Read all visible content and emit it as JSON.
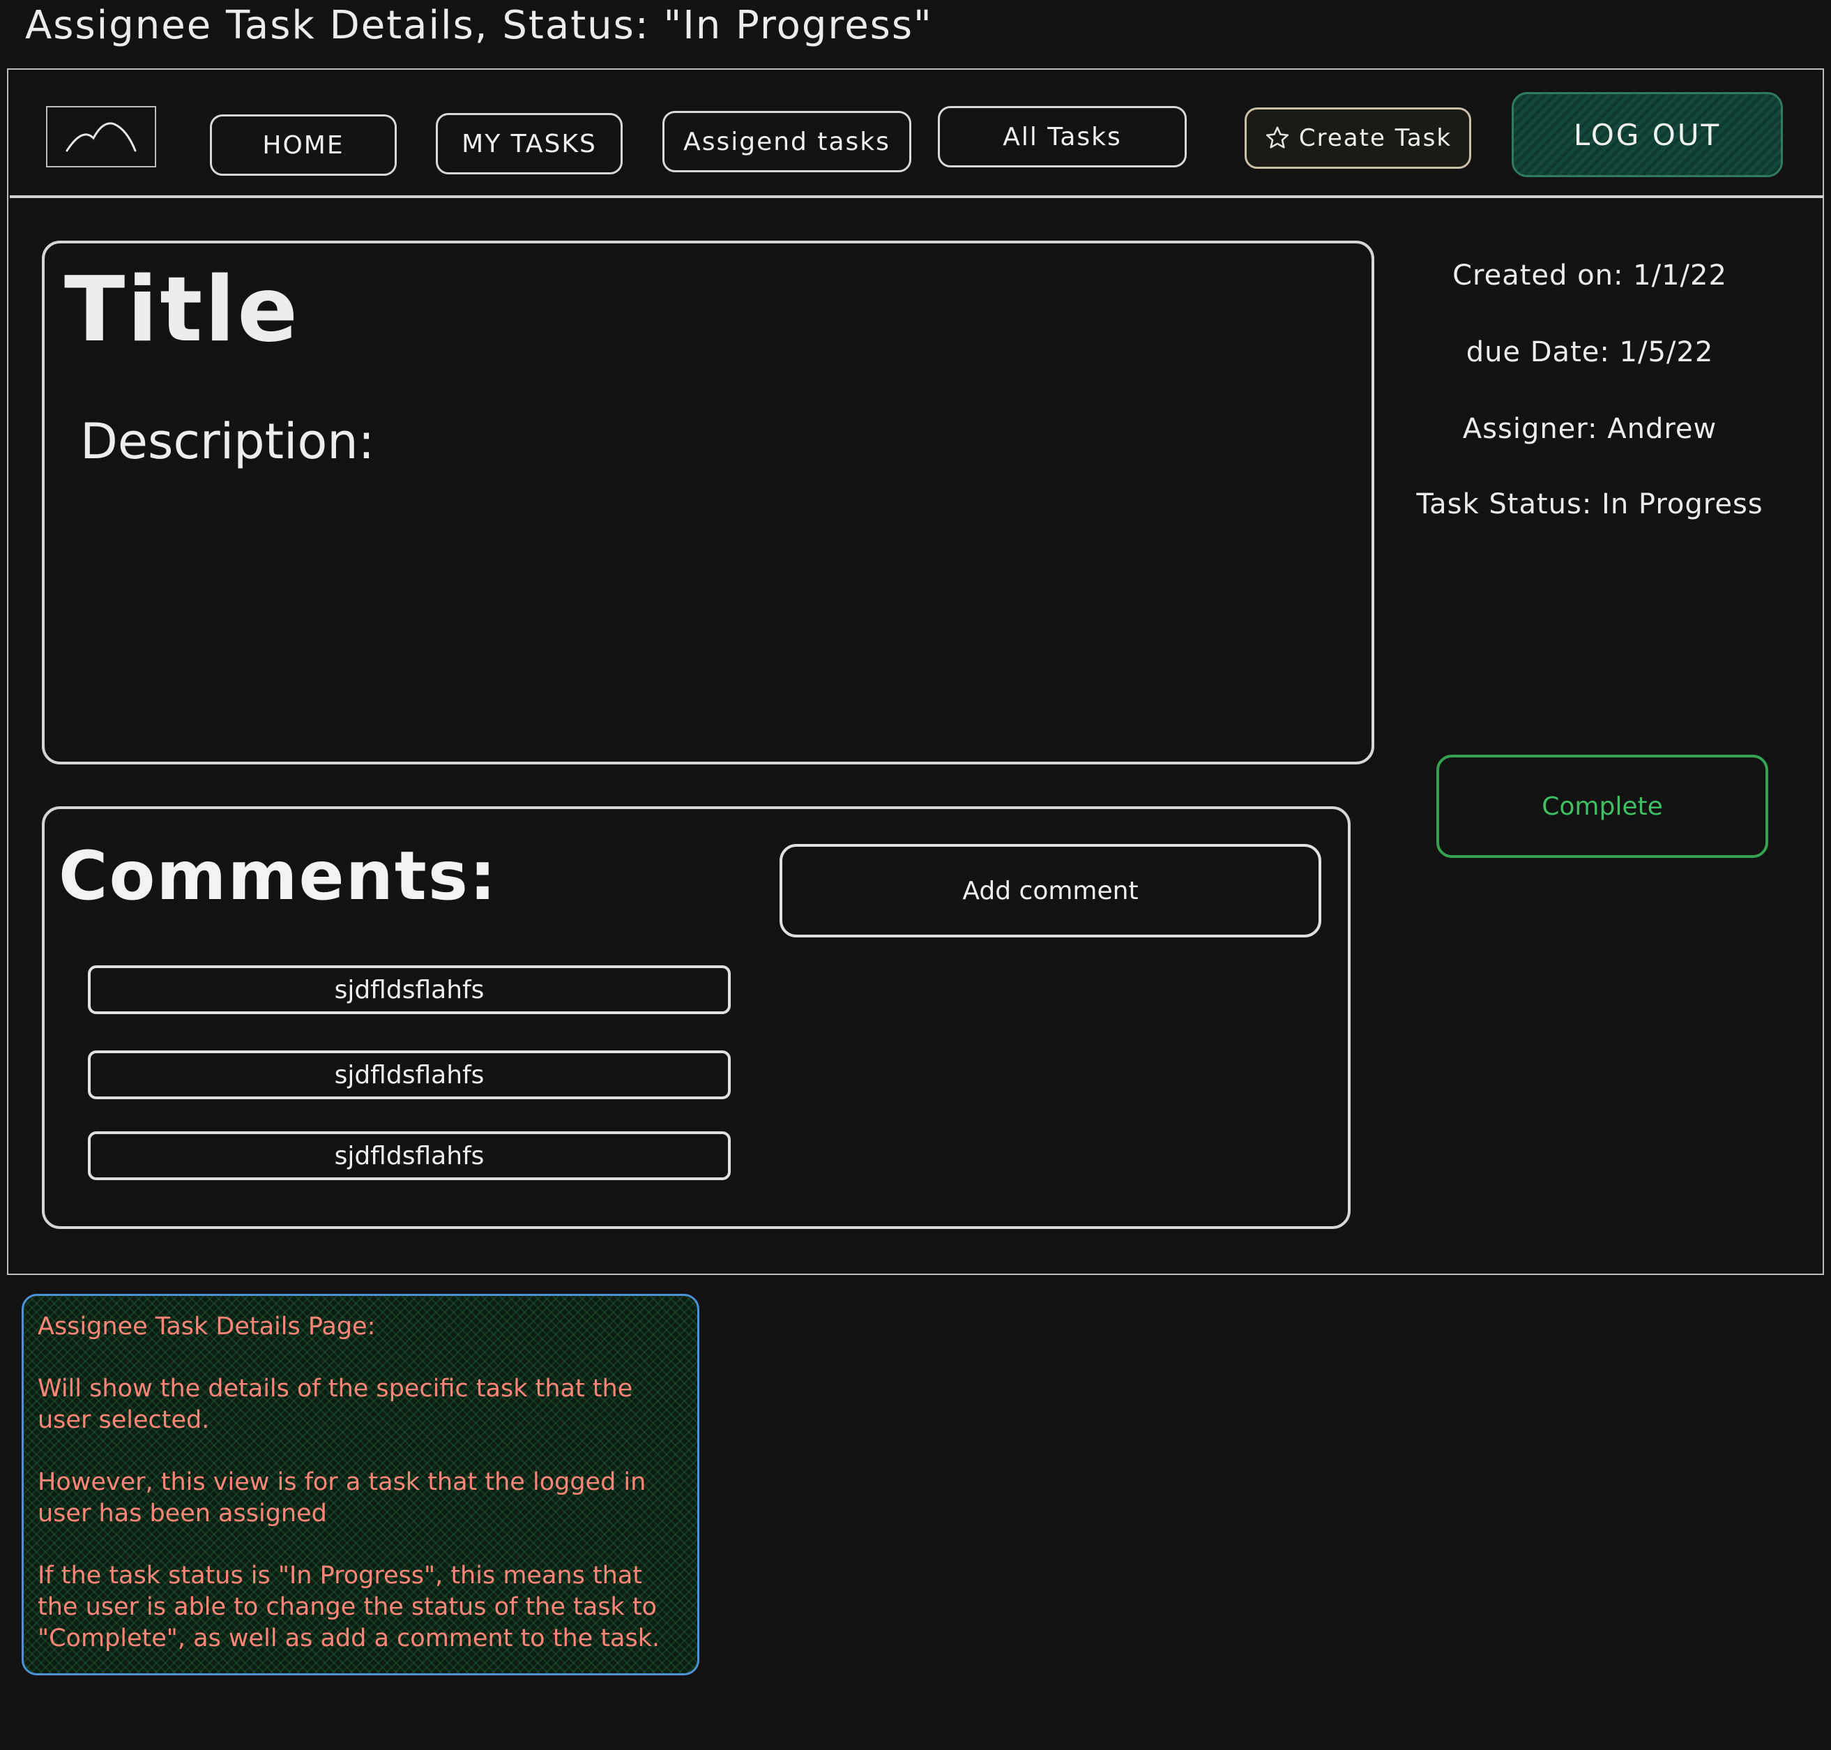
{
  "page": {
    "heading": "Assignee Task Details, Status: \"In Progress\""
  },
  "nav": {
    "logo_icon": "image-placeholder-icon",
    "home": "HOME",
    "my_tasks": "MY TASKS",
    "assigned_tasks": "Assigend tasks",
    "all_tasks": "All Tasks",
    "create_task": "Create Task",
    "create_task_icon": "star-icon",
    "logout": "LOG OUT"
  },
  "task": {
    "title": "Title",
    "description_label": "Description:",
    "created_on": "Created on: 1/1/22",
    "due_date": "due Date: 1/5/22",
    "assigner": "Assigner: Andrew",
    "status": "Task Status: In Progress",
    "complete_button": "Complete"
  },
  "comments": {
    "label": "Comments:",
    "add_button": "Add comment",
    "items": [
      "sjdfldsflahfs",
      "sjdfldsflahfs",
      "sjdfldsflahfs"
    ]
  },
  "note": {
    "heading": "Assignee Task Details Page:",
    "paragraph1": "Will show the details of the specific task that the user selected.",
    "paragraph2": "However, this view is for a task that the logged in user has been assigned",
    "paragraph3": "If the task status is \"In Progress\", this means that the user is able to change the status of the task to \"Complete\", as well as add a comment to the task."
  },
  "colors": {
    "background": "#121212",
    "complete_green": "#33a352",
    "logout_green": "#14483a",
    "note_text": "#ff8579",
    "note_border": "#4d92d6"
  }
}
